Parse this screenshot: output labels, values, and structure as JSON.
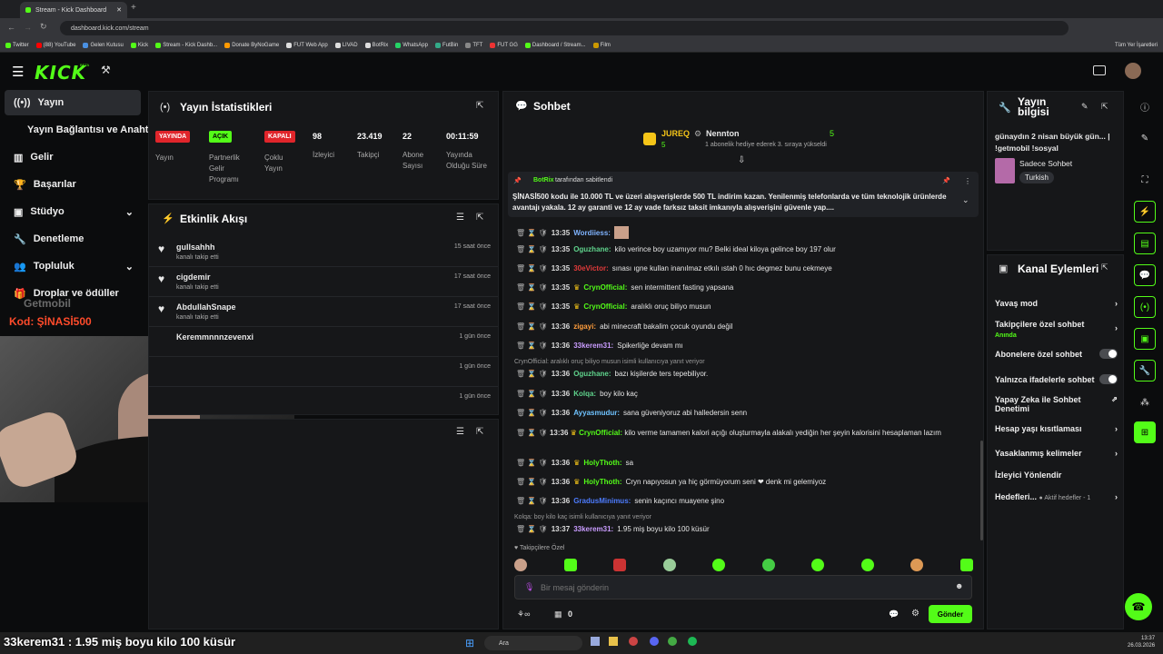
{
  "browser": {
    "tab_title": "Stream - Kick Dashboard",
    "url": "dashboard.kick.com/stream",
    "bookmarks": [
      "Twitter",
      "(88) YouTube",
      "Gelen Kutusu",
      "Kick",
      "Stream - Kick Dashb...",
      "Donate ByNoGame",
      "FUT Web App",
      "LIVAD",
      "BotRix",
      "WhatsApp",
      "FutBin",
      "TFT",
      "FUT GG",
      "Dashboard / Stream...",
      "Film"
    ],
    "all_bookmarks": "Tüm Yer İşaretleri"
  },
  "header": {
    "logo": "KICK",
    "beta": "BETA"
  },
  "nav": {
    "items": [
      "Yayın",
      "Yayın Bağlantısı ve Anahtarı",
      "Gelir",
      "Başarılar",
      "Stüdyo",
      "Denetleme",
      "Topluluk",
      "Droplar ve ödüller"
    ]
  },
  "overlay": {
    "code": "Kod: ŞİNASİ500",
    "watermark": "Getmobil",
    "ticker": "33kerem31 : 1.95 miş boyu kilo 100 küsür"
  },
  "stats": {
    "title": "Yayın İstatistikleri",
    "items": [
      {
        "tag": "YAYINDA",
        "label": "Yayın"
      },
      {
        "tag": "AÇIK",
        "label": "Partnerlik Gelir Programı"
      },
      {
        "tag": "KAPALI",
        "label": "Çoklu Yayın"
      },
      {
        "value": "98",
        "label": "İzleyici"
      },
      {
        "value": "23.419",
        "label": "Takipçi"
      },
      {
        "value": "22",
        "label": "Abone Sayısı"
      },
      {
        "value": "00:11:59",
        "label": "Yayında Olduğu Süre"
      }
    ]
  },
  "activity": {
    "title": "Etkinlik Akışı",
    "rows": [
      {
        "name": "gullsahhh",
        "action": "kanalı takip etti",
        "time": "15 saat önce"
      },
      {
        "name": "cigdemir",
        "action": "kanalı takip etti",
        "time": "17 saat önce"
      },
      {
        "name": "AbdullahSnape",
        "action": "kanalı takip etti",
        "time": "17 saat önce"
      },
      {
        "name": "Keremmnnnzevenxi",
        "action": "",
        "time": "1 gün önce"
      },
      {
        "name": "",
        "action": "",
        "time": "1 gün önce"
      },
      {
        "name": "",
        "action": "",
        "time": "1 gün önce"
      }
    ]
  },
  "chat": {
    "title": "Sohbet",
    "top_gifter": {
      "name": "JUREQ",
      "count": "5"
    },
    "gift_notice": {
      "name": "Nennton",
      "count": "5",
      "text": "1 abonelik hediye ederek 3. sıraya yükseldi"
    },
    "pinned": {
      "by": "BotRix",
      "by_suffix": "tarafından sabitlendi",
      "text": "ŞİNASİ500 kodu ile 10.000 TL ve üzeri alışverişlerde 500 TL indirim kazan.  Yenilenmiş telefonlarda ve tüm teknolojik ürünlerde avantajı yakala. 12 ay garanti ve 12 ay vade farksız taksit imkanıyla alışverişini güvenle yap...."
    },
    "messages": [
      {
        "time": "13:35",
        "user": "Wordiiess:",
        "color": "#7fb3ff",
        "text": ""
      },
      {
        "time": "13:35",
        "user": "Oguzhane:",
        "color": "#5fd38c",
        "text": "kilo verince boy uzamıyor mu? Belki ideal kiloya gelince boy 197 olur"
      },
      {
        "time": "13:35",
        "user": "30eVictor:",
        "color": "#e03a3a",
        "text": "sınası ıgne kullan inanılmaz etkılı ıstah 0 hıc degmez bunu cekmeye"
      },
      {
        "time": "13:35",
        "user": "CrynOfficial:",
        "color": "#53fc18",
        "text": "sen intermittent fasting yapsana"
      },
      {
        "time": "13:35",
        "user": "CrynOfficial:",
        "color": "#53fc18",
        "text": "aralıklı oruç biliyo musun"
      },
      {
        "time": "13:36",
        "user": "zigayi:",
        "color": "#ff9d3c",
        "text": "abi minecraft bakalim çocuk oyundu değil"
      },
      {
        "time": "13:36",
        "user": "33kerem31:",
        "color": "#c99cff",
        "text": "Spikerliğe devam mı"
      },
      {
        "time": "13:36",
        "user": "Oguzhane:",
        "color": "#5fd38c",
        "text": "bazı kişilerde ters tepebiliyor.",
        "reply": "CrynOfficial: aralıklı oruç biliyo musun isimli kullanıcıya yanıt veriyor"
      },
      {
        "time": "13:36",
        "user": "Kolqa:",
        "color": "#5fd38c",
        "text": "boy kilo kaç"
      },
      {
        "time": "13:36",
        "user": "Ayyasmudur:",
        "color": "#6fc3ff",
        "text": "sana güveniyoruz abi halledersin senn"
      },
      {
        "time": "13:36",
        "user": "CrynOfficial:",
        "color": "#53fc18",
        "text": "kilo verme tamamen kalori açığı oluşturmayla alakalı yediğin her şeyin kalorisini hesaplaman lazım"
      },
      {
        "time": "13:36",
        "user": "HolyThoth:",
        "color": "#53fc18",
        "text": "sa"
      },
      {
        "time": "13:36",
        "user": "HolyThoth:",
        "color": "#53fc18",
        "text": "Cryn napıyosun ya hiç görmüyorum seni ❤ denk mi gelemiyoz"
      },
      {
        "time": "13:36",
        "user": "GradusMinimus:",
        "color": "#4d7cff",
        "text": "senin kaçıncı muayene şino"
      },
      {
        "time": "13:37",
        "user": "33kerem31:",
        "color": "#c99cff",
        "text": "1.95 miş boyu kilo 100 küsür",
        "reply": "Kolqa: boy kilo kaç isimli kullanıcıya yanıt veriyor"
      }
    ],
    "followers_only": "Takipçilere Özel",
    "input_placeholder": "Bir mesaj gönderin",
    "count": "0",
    "send": "Gönder"
  },
  "stream_info": {
    "title": "Yayın bilgisi",
    "stream_title": "günaydın 2 nisan büyük gün... | !getmobil !sosyal",
    "category": "Sadece Sohbet",
    "language": "Turkish"
  },
  "channel_actions": {
    "title": "Kanal Eylemleri",
    "items": [
      {
        "label": "Yavaş mod"
      },
      {
        "label": "Takipçilere özel sohbet",
        "sub": "Anında"
      },
      {
        "label": "Abonelere özel sohbet"
      },
      {
        "label": "Yalnızca ifadelerle sohbet"
      },
      {
        "label": "Yapay Zeka ile Sohbet Denetimi"
      },
      {
        "label": "Hesap yaşı kısıtlaması"
      },
      {
        "label": "Yasaklanmış kelimeler"
      },
      {
        "label": "İzleyici Yönlendir"
      },
      {
        "label": "Hedefleri...",
        "sub": "Aktif hedefler - 1"
      }
    ]
  },
  "system": {
    "search": "Ara",
    "time": "13:37",
    "date": "26.03.2026"
  }
}
